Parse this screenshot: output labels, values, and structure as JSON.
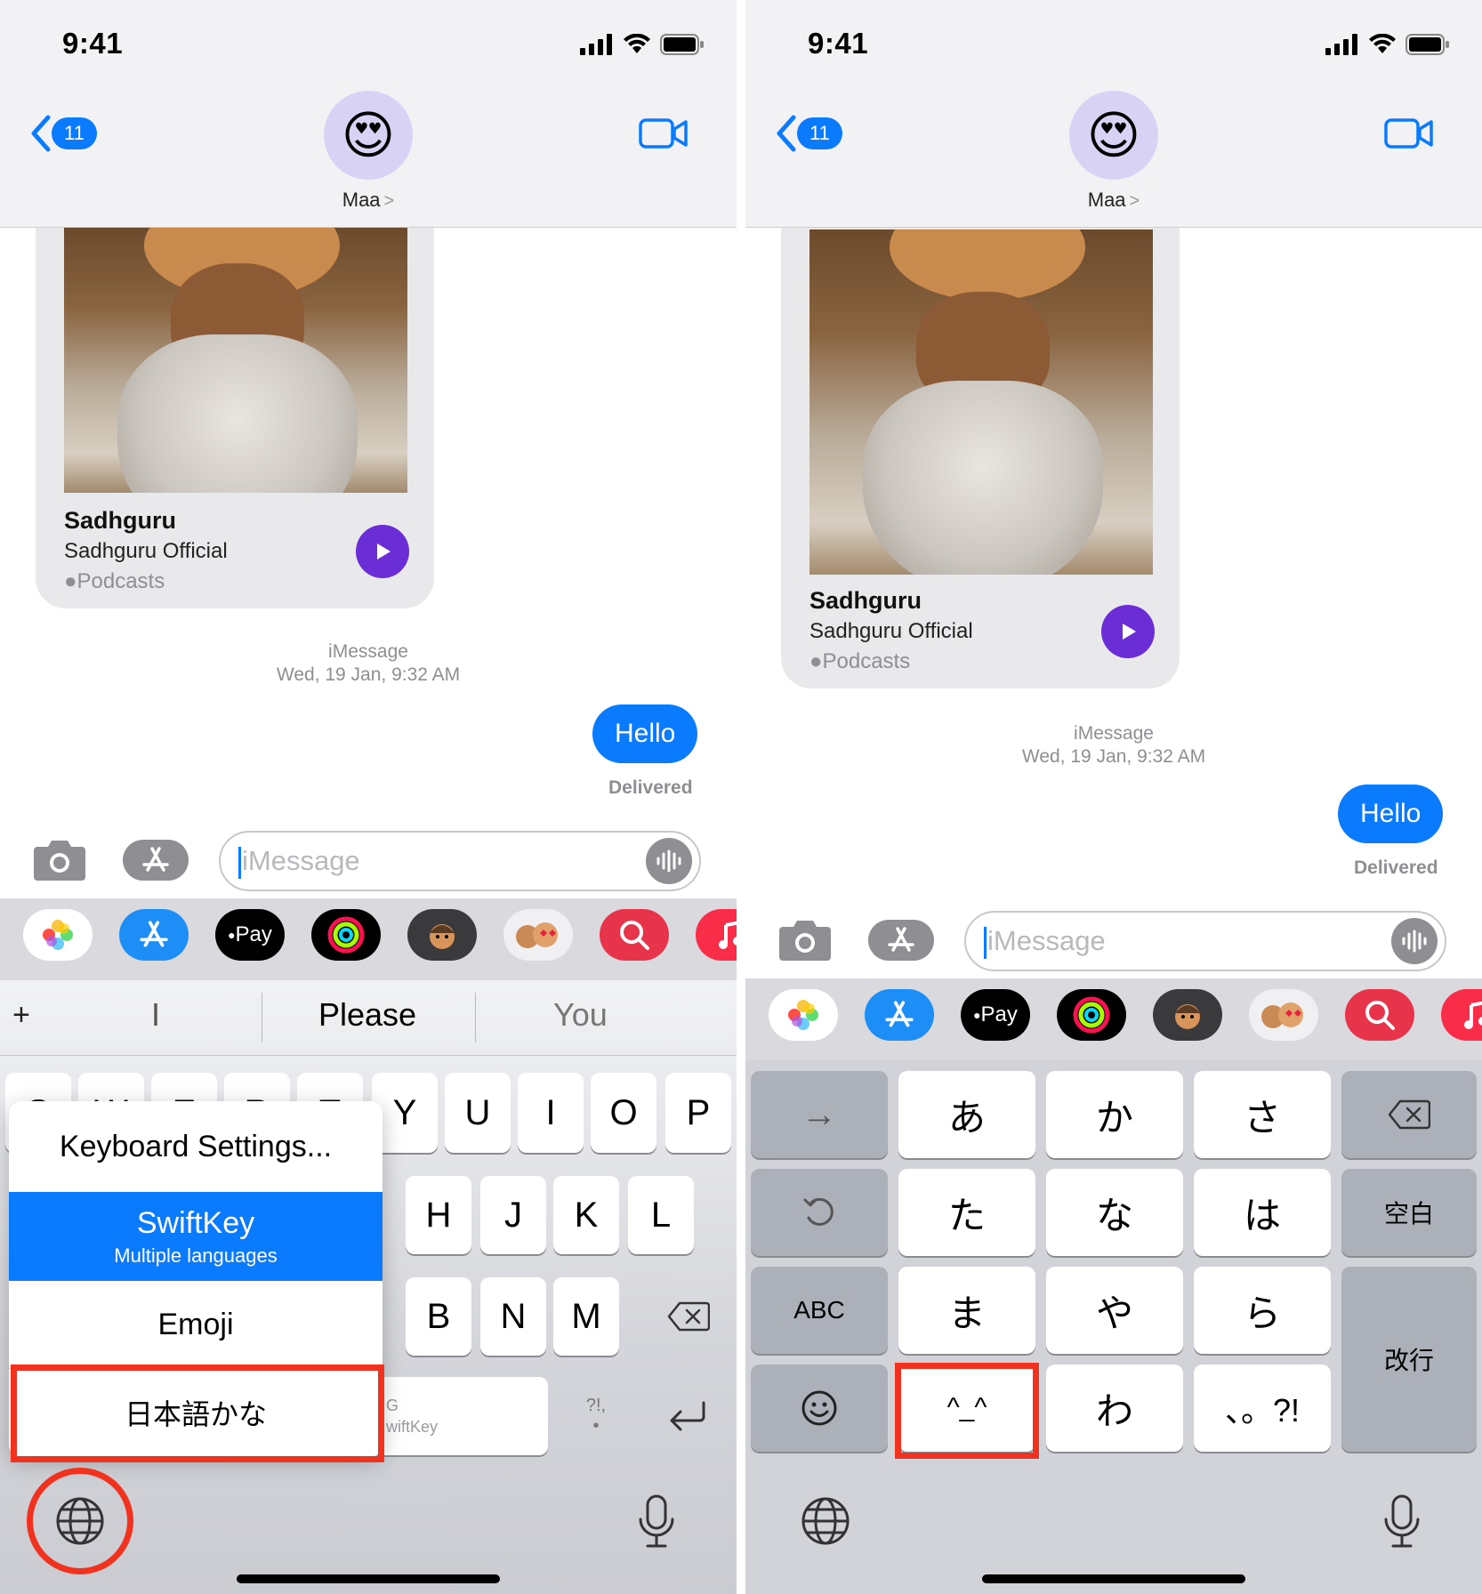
{
  "left": {
    "status": {
      "time": "9:41"
    },
    "header": {
      "back_count": "11",
      "contact_name": "Maa",
      "contact_chevron": ">",
      "avatar_emoji": "😍"
    },
    "podcast": {
      "title": "Sadhguru",
      "subtitle": "Sadhguru Official",
      "source": "Podcasts"
    },
    "timestamp": {
      "service": "iMessage",
      "date": "Wed, 19 Jan, 9:32 AM"
    },
    "message": {
      "text": "Hello",
      "status": "Delivered"
    },
    "input": {
      "placeholder": "iMessage"
    },
    "suggestions": {
      "plus": "+",
      "first": "I",
      "second": "Please",
      "third": "You"
    },
    "keys_row1": [
      "Q",
      "W",
      "E",
      "R",
      "T",
      "Y",
      "U",
      "I",
      "O",
      "P"
    ],
    "keys_row2": [
      "H",
      "J",
      "K",
      "L"
    ],
    "keys_row3": [
      "B",
      "N",
      "M"
    ],
    "space_keys": {
      "g": "G",
      "swiftkey": "wiftKey",
      "punct": "?!,"
    },
    "popup": {
      "settings": "Keyboard Settings...",
      "swiftkey": "SwiftKey",
      "swiftkey_sub": "Multiple languages",
      "emoji": "Emoji",
      "japanese": "日本語かな"
    }
  },
  "right": {
    "status": {
      "time": "9:41"
    },
    "header": {
      "back_count": "11",
      "contact_name": "Maa",
      "contact_chevron": ">",
      "avatar_emoji": "😍"
    },
    "podcast": {
      "title": "Sadhguru",
      "subtitle": "Sadhguru Official",
      "source": "Podcasts"
    },
    "timestamp": {
      "service": "iMessage",
      "date": "Wed, 19 Jan, 9:32 AM"
    },
    "message": {
      "text": "Hello",
      "status": "Delivered"
    },
    "input": {
      "placeholder": "iMessage"
    },
    "kana": {
      "arrow": "→",
      "a": "あ",
      "ka": "か",
      "sa": "さ",
      "ta": "た",
      "na": "な",
      "ha": "は",
      "abc": "ABC",
      "ma": "ま",
      "ya": "や",
      "ra": "ら",
      "emoticon": "^_^",
      "wa": "わ",
      "punct": "、。?!",
      "space": "空白",
      "enter": "改行"
    }
  },
  "apps": {
    "apple_pay": "Pay"
  },
  "colors": {
    "accent": "#0a7aff",
    "highlight": "#f0321e",
    "play": "#6b2ed6"
  }
}
